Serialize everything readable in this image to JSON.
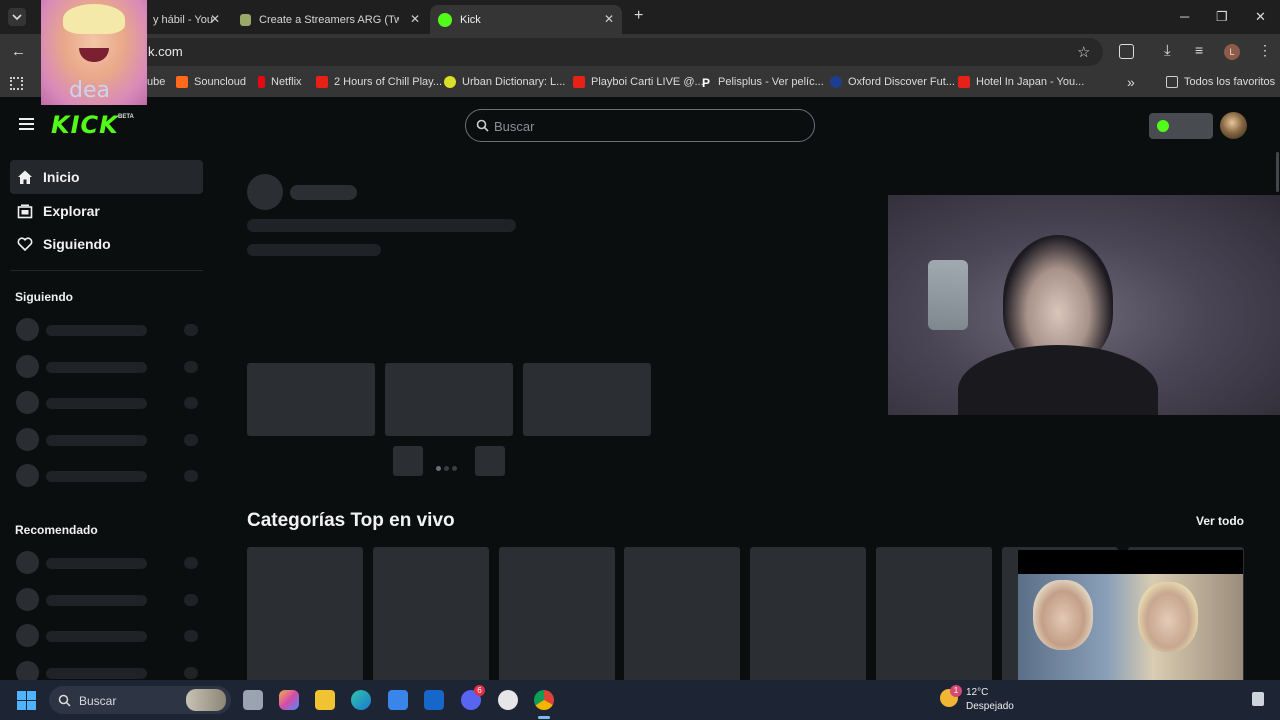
{
  "browser": {
    "tabs": [
      {
        "label": "y hábil - You",
        "active": false
      },
      {
        "label": "Create a Streamers ARG (Twich/",
        "active": false
      },
      {
        "label": "Kick",
        "active": true
      }
    ],
    "new_tab": "+",
    "url": "k.com",
    "bookmarks": [
      "ube",
      "Souncloud",
      "Netflix",
      "2 Hours of Chill Play...",
      "Urban Dictionary: L...",
      "Playboi Carti LIVE @...",
      "Pelisplus - Ver pelíc...",
      "Oxford Discover Fut...",
      "Hotel In Japan - You..."
    ],
    "bookmarks_overflow": "»",
    "all_bookmarks": "Todos los favoritos",
    "profile_initial": "L"
  },
  "kick": {
    "logo": "KICK",
    "logo_badge": "BETA",
    "search_placeholder": "Buscar",
    "nav": [
      {
        "label": "Inicio",
        "icon": "home-icon",
        "active": true
      },
      {
        "label": "Explorar",
        "icon": "explore-icon",
        "active": false
      },
      {
        "label": "Siguiendo",
        "icon": "heart-icon",
        "active": false
      }
    ],
    "following_heading": "Siguiendo",
    "recommended_heading": "Recomendado",
    "top_categories_title": "Categorías Top en vivo",
    "see_all": "Ver todo"
  },
  "overlay": {
    "sticker_text": "dea"
  },
  "taskbar": {
    "search_placeholder": "Buscar",
    "weather_temp": "12°C",
    "weather_desc": "Despejado",
    "weather_badge": "1",
    "discord_badge": "6"
  },
  "colors": {
    "kick_green": "#53fc18",
    "page_bg": "#0b0e0f",
    "skeleton": "#2b2e33"
  }
}
